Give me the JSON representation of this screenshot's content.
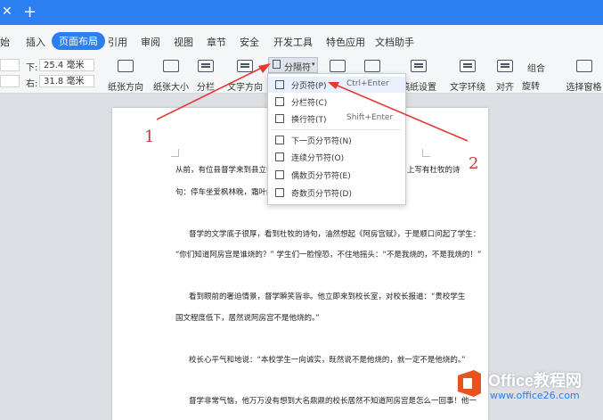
{
  "tabbar": {
    "close_icon": "✕",
    "add_icon": "+"
  },
  "menu": [
    "始",
    "插入",
    "页面布局",
    "引用",
    "审阅",
    "视图",
    "章节",
    "安全",
    "开发工具",
    "特色应用",
    "文档助手"
  ],
  "toolbar": {
    "bottom_label": "下:",
    "bottom_value": "25.4 毫米",
    "right_label": "右:",
    "right_value": "31.8 毫米",
    "buttons": [
      "纸张方向",
      "纸张大小",
      "分栏",
      "文字方向",
      "稿纸设置",
      "文字环绕",
      "对齐",
      "旋转",
      "选择窗格"
    ],
    "combine_label": "组合",
    "breaks_button": "分隔符"
  },
  "dropdown": {
    "items": [
      {
        "label": "分页符(P)",
        "shortcut": "Ctrl+Enter"
      },
      {
        "label": "分栏符(C)",
        "shortcut": ""
      },
      {
        "label": "换行符(T)",
        "shortcut": "Shift+Enter"
      },
      {
        "label": "下一页分节符(N)",
        "shortcut": ""
      },
      {
        "label": "连续分节符(O)",
        "shortcut": ""
      },
      {
        "label": "偶数页分节符(E)",
        "shortcut": ""
      },
      {
        "label": "奇数页分节符(D)",
        "shortcut": ""
      }
    ]
  },
  "annotations": {
    "num1": "1",
    "num2": "2",
    "arrow_color": "#e53935"
  },
  "document": {
    "paragraphs": [
      "从前，有位县督学来到县立中学",
      "句：停车坐爱枫林晚，霜叶红于",
      "督学的文学底子很厚，看到杜牧的诗句，油然想起《阿房宫赋》，于是顺口问起了学生：",
      "“你们知道阿房宫是谁烧的？” 学生们一脸惶恐，不住地摇头：“不是我烧的，不是我烧的！”",
      "看到眼前的奢迫情景，督学瞬笑皆非。他立即来到校长室，对校长报道：“贵校学生",
      "国文程度低下，居然说阿房宫不是他烧的。”",
      "校长心平气和地说：“本校学生一向诚实，既然说不是他烧的，就一定不是他烧的。”",
      "督学非常气恼，他万万没有想到大名鼎鼎的校长居然不知道阿房宫是怎么一回事！他一"
    ],
    "line1_tail": "上写有杜牧的诗"
  },
  "watermark": {
    "brand": "Office教程网",
    "url": "www.office26.com"
  }
}
